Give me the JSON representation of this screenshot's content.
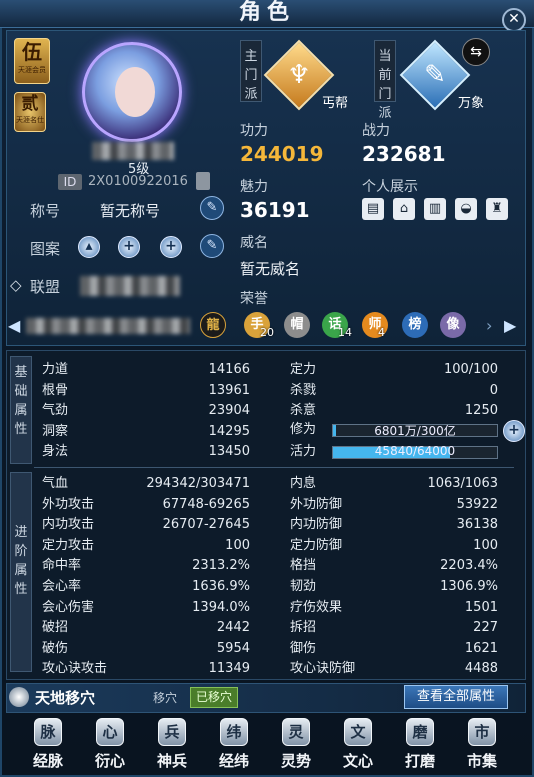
{
  "window": {
    "title": "角色",
    "close": "✕"
  },
  "badges": {
    "vip": {
      "big": "伍",
      "small": "天涯会员"
    },
    "rank": {
      "big": "贰",
      "small": "天涯名仕"
    }
  },
  "profile": {
    "level": "5级",
    "id_label": "ID",
    "id_value": "2X0100922016",
    "title_label": "称号",
    "title_value": "暂无称号",
    "pattern_label": "图案",
    "league_label": "联盟"
  },
  "schools": {
    "main_label": "主门派",
    "main_name": "丐帮",
    "current_label": "当前门派",
    "current_name": "万象"
  },
  "attributes": {
    "skill_label": "功力",
    "skill_value": "244019",
    "power_label": "战力",
    "power_value": "232681",
    "charm_label": "魅力",
    "charm_value": "36191",
    "showcase_label": "个人展示",
    "fame_label": "威名",
    "fame_value": "暂无威名",
    "honor_label": "荣誉",
    "honors": [
      {
        "glyph": "手",
        "count": "20",
        "color": "#d9a23a"
      },
      {
        "glyph": "帽",
        "count": "",
        "color": "#8d8d8d"
      },
      {
        "glyph": "话",
        "count": "14",
        "color": "#3aa54a"
      },
      {
        "glyph": "师",
        "count": "4",
        "color": "#e58a1e"
      },
      {
        "glyph": "榜",
        "count": "",
        "color": "#2d6cb7"
      },
      {
        "glyph": "像",
        "count": "",
        "color": "#7a6aa8"
      }
    ],
    "showcase_icons": [
      "card-icon",
      "house-icon",
      "building-icon",
      "car-icon",
      "outfit-icon"
    ]
  },
  "basic": {
    "section_label": "基础属性",
    "left": [
      {
        "k": "力道",
        "v": "14166"
      },
      {
        "k": "根骨",
        "v": "13961"
      },
      {
        "k": "气劲",
        "v": "23904"
      },
      {
        "k": "洞察",
        "v": "14295"
      },
      {
        "k": "身法",
        "v": "13450"
      }
    ],
    "right": [
      {
        "k": "定力",
        "v": "100/100"
      },
      {
        "k": "杀戮",
        "v": "0"
      },
      {
        "k": "杀意",
        "v": "1250"
      }
    ],
    "cultivation_label": "修为",
    "cultivation_text": "6801万/300亿",
    "cultivation_fraction": 0.002,
    "vitality_label": "活力",
    "vitality_text": "45840/64000",
    "vitality_fraction": 0.716
  },
  "advanced": {
    "section_label": "进阶属性",
    "left": [
      {
        "k": "气血",
        "v": "294342/303471"
      },
      {
        "k": "外功攻击",
        "v": "67748-69265"
      },
      {
        "k": "内功攻击",
        "v": "26707-27645"
      },
      {
        "k": "定力攻击",
        "v": "100"
      },
      {
        "k": "命中率",
        "v": "2313.2%"
      },
      {
        "k": "会心率",
        "v": "1636.9%"
      },
      {
        "k": "会心伤害",
        "v": "1394.0%"
      },
      {
        "k": "破招",
        "v": "2442"
      },
      {
        "k": "破伤",
        "v": "5954"
      },
      {
        "k": "攻心诀攻击",
        "v": "11349"
      }
    ],
    "right": [
      {
        "k": "内息",
        "v": "1063/1063"
      },
      {
        "k": "外功防御",
        "v": "53922"
      },
      {
        "k": "内功防御",
        "v": "36138"
      },
      {
        "k": "定力防御",
        "v": "100"
      },
      {
        "k": "格挡",
        "v": "2203.4%"
      },
      {
        "k": "韧劲",
        "v": "1306.9%"
      },
      {
        "k": "疗伤效果",
        "v": "1501"
      },
      {
        "k": "拆招",
        "v": "227"
      },
      {
        "k": "御伤",
        "v": "1621"
      },
      {
        "k": "攻心诀防御",
        "v": "4488"
      }
    ]
  },
  "tiandi": {
    "name": "天地移穴",
    "label": "移穴",
    "status": "已移穴",
    "view_all": "查看全部属性"
  },
  "nav": [
    {
      "label": "经脉",
      "glyph": "脉",
      "name": "meridian"
    },
    {
      "label": "衍心",
      "glyph": "心",
      "name": "yanxin"
    },
    {
      "label": "神兵",
      "glyph": "兵",
      "name": "weapon"
    },
    {
      "label": "经纬",
      "glyph": "纬",
      "name": "jingwei"
    },
    {
      "label": "灵势",
      "glyph": "灵",
      "name": "lingshi"
    },
    {
      "label": "文心",
      "glyph": "文",
      "name": "wenxin"
    },
    {
      "label": "打磨",
      "glyph": "磨",
      "name": "polish"
    },
    {
      "label": "市集",
      "glyph": "市",
      "name": "market"
    }
  ]
}
